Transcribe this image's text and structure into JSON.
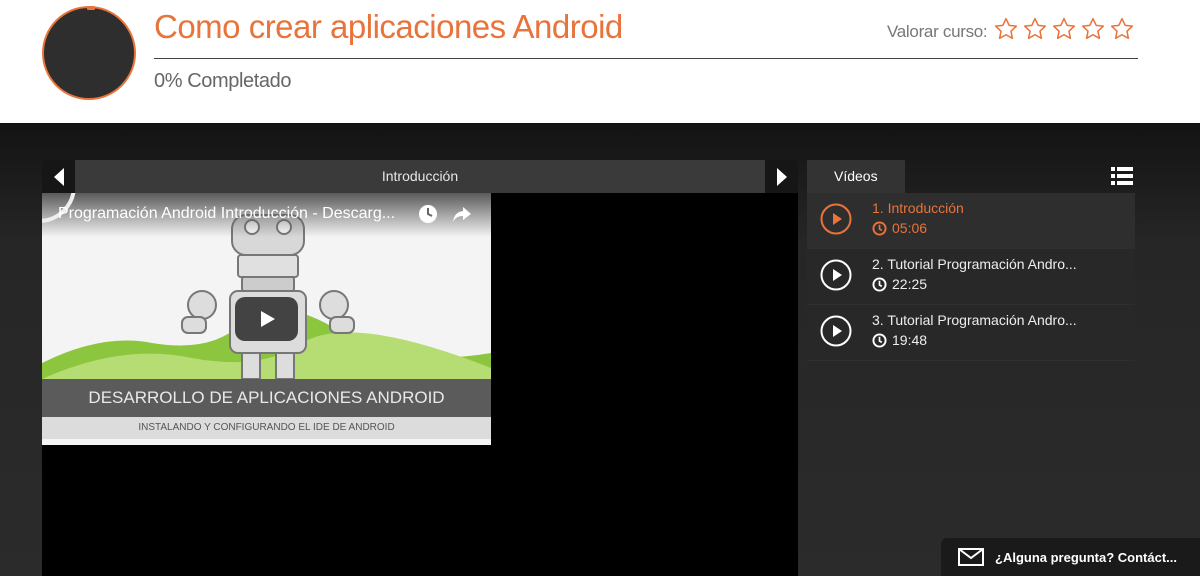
{
  "header": {
    "course_title": "Como crear aplicaciones Android",
    "progress_text": "0% Completado",
    "rate_label": "Valorar curso:",
    "star_count": 5,
    "accent_color": "#e8743b"
  },
  "player": {
    "current_title": "Introducción",
    "prev_icon": "chevron-left-icon",
    "next_icon": "chevron-right-icon",
    "video": {
      "title": "Programación Android Introducción - Descarg...",
      "banner_main": "DESARROLLO DE APLICACIONES ANDROID",
      "banner_sub": "INSTALANDO Y CONFIGURANDO EL IDE DE ANDROID",
      "icons": [
        "clock-icon",
        "share-icon",
        "play-icon"
      ]
    }
  },
  "sidebar": {
    "tab_label": "Vídeos",
    "list_icon": "list-icon",
    "items": [
      {
        "title": "1. Introducción",
        "duration": "05:06",
        "active": true
      },
      {
        "title": "2. Tutorial Programación Andro...",
        "duration": "22:25",
        "active": false
      },
      {
        "title": "3. Tutorial Programación Andro...",
        "duration": "19:48",
        "active": false
      }
    ]
  },
  "contact": {
    "label": "¿Alguna pregunta? Contáct...",
    "icon": "envelope-icon"
  }
}
